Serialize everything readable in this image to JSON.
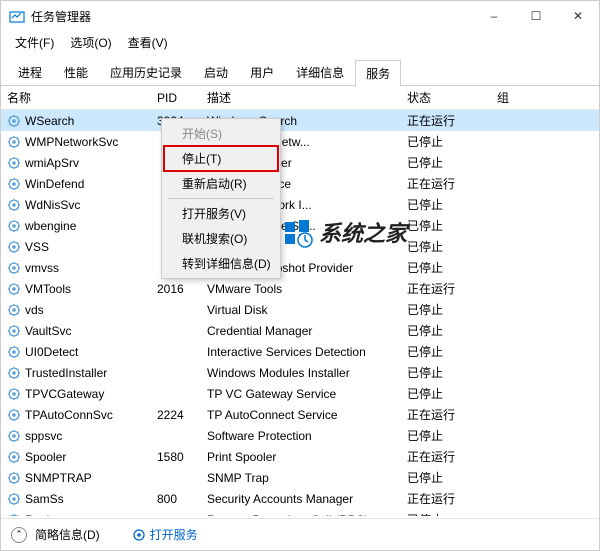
{
  "window": {
    "title": "任务管理器",
    "menu": {
      "file": "文件(F)",
      "options": "选项(O)",
      "view": "查看(V)"
    },
    "controls": {
      "min": "–",
      "max": "☐",
      "close": "✕"
    }
  },
  "tabs": {
    "items": [
      "进程",
      "性能",
      "应用历史记录",
      "启动",
      "用户",
      "详细信息",
      "服务"
    ],
    "active": 6
  },
  "columns": {
    "name": "名称",
    "pid": "PID",
    "desc": "描述",
    "status": "状态",
    "group": "组"
  },
  "services": [
    {
      "name": "WSearch",
      "pid": "3904",
      "desc": "Windows Search",
      "status": "正在运行",
      "selected": true
    },
    {
      "name": "WMPNetworkSvc",
      "pid": "",
      "desc": "ledia Player Netw...",
      "status": "已停止"
    },
    {
      "name": "wmiApSrv",
      "pid": "",
      "desc": "rmance Adapter",
      "status": "已停止"
    },
    {
      "name": "WinDefend",
      "pid": "",
      "desc": "efender Service",
      "status": "正在运行"
    },
    {
      "name": "WdNisSvc",
      "pid": "",
      "desc": "efender Network I...",
      "status": "已停止"
    },
    {
      "name": "wbengine",
      "pid": "",
      "desc": "Backup Engine Se...",
      "status": "已停止"
    },
    {
      "name": "VSS",
      "pid": "",
      "desc": "",
      "status": "已停止"
    },
    {
      "name": "vmvss",
      "pid": "",
      "desc": "VMware Snapshot Provider",
      "status": "已停止"
    },
    {
      "name": "VMTools",
      "pid": "2016",
      "desc": "VMware Tools",
      "status": "正在运行"
    },
    {
      "name": "vds",
      "pid": "",
      "desc": "Virtual Disk",
      "status": "已停止"
    },
    {
      "name": "VaultSvc",
      "pid": "",
      "desc": "Credential Manager",
      "status": "已停止"
    },
    {
      "name": "UI0Detect",
      "pid": "",
      "desc": "Interactive Services Detection",
      "status": "已停止"
    },
    {
      "name": "TrustedInstaller",
      "pid": "",
      "desc": "Windows Modules Installer",
      "status": "已停止"
    },
    {
      "name": "TPVCGateway",
      "pid": "",
      "desc": "TP VC Gateway Service",
      "status": "已停止"
    },
    {
      "name": "TPAutoConnSvc",
      "pid": "2224",
      "desc": "TP AutoConnect Service",
      "status": "正在运行"
    },
    {
      "name": "sppsvc",
      "pid": "",
      "desc": "Software Protection",
      "status": "已停止"
    },
    {
      "name": "Spooler",
      "pid": "1580",
      "desc": "Print Spooler",
      "status": "正在运行"
    },
    {
      "name": "SNMPTRAP",
      "pid": "",
      "desc": "SNMP Trap",
      "status": "已停止"
    },
    {
      "name": "SamSs",
      "pid": "800",
      "desc": "Security Accounts Manager",
      "status": "正在运行"
    },
    {
      "name": "RpcLocator",
      "pid": "",
      "desc": "Remote Procedure Call (RPC) ...",
      "status": "已停止"
    }
  ],
  "context_menu": {
    "start": "开始(S)",
    "stop": "停止(T)",
    "restart": "重新启动(R)",
    "open_services": "打开服务(V)",
    "search_online": "联机搜索(O)",
    "goto_details": "转到详细信息(D)"
  },
  "statusbar": {
    "brief": "简略信息(D)",
    "open_services": "打开服务"
  },
  "watermark": "系统之家"
}
